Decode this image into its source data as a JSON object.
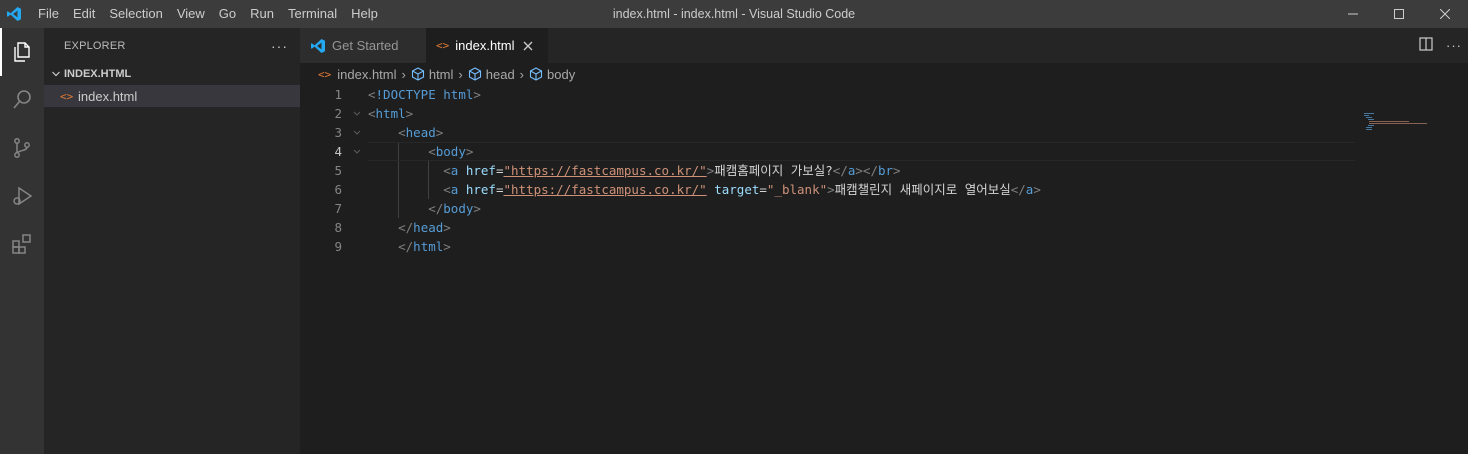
{
  "window": {
    "title": "index.html - index.html - Visual Studio Code",
    "menu": [
      "File",
      "Edit",
      "Selection",
      "View",
      "Go",
      "Run",
      "Terminal",
      "Help"
    ]
  },
  "activity_bar": {
    "items": [
      "explorer-icon",
      "search-icon",
      "source-control-icon",
      "run-debug-icon",
      "extensions-icon"
    ]
  },
  "sidebar": {
    "title": "EXPLORER",
    "more": "···",
    "folder": "INDEX.HTML",
    "files": [
      {
        "icon": "<>",
        "name": "index.html"
      }
    ]
  },
  "tabs": [
    {
      "label": "Get Started",
      "active": false
    },
    {
      "label": "index.html",
      "active": true
    }
  ],
  "breadcrumb": {
    "file": "index.html",
    "items": [
      "html",
      "head",
      "body"
    ]
  },
  "code": {
    "current_line": 4,
    "lines": [
      {
        "n": "1",
        "text": "<!DOCTYPE html>"
      },
      {
        "n": "2",
        "text": "<html>"
      },
      {
        "n": "3",
        "text": "    <head>"
      },
      {
        "n": "4",
        "text": "        <body>"
      },
      {
        "n": "5",
        "text": "          <a href=\"https://fastcampus.co.kr/\">패캠홈페이지 가보실?</a></br>"
      },
      {
        "n": "6",
        "text": "          <a href=\"https://fastcampus.co.kr/\" target=\"_blank\">패캠챌린지 새페이지로 열어보실</a>"
      },
      {
        "n": "7",
        "text": "        </body>"
      },
      {
        "n": "8",
        "text": "    </head>"
      },
      {
        "n": "9",
        "text": "    </html>"
      }
    ]
  },
  "colors": {
    "tag": "#569cd6",
    "attribute": "#9cdcfe",
    "string": "#ce9178",
    "text": "#d4d4d4",
    "vscode_blue": "#23a9f2"
  }
}
